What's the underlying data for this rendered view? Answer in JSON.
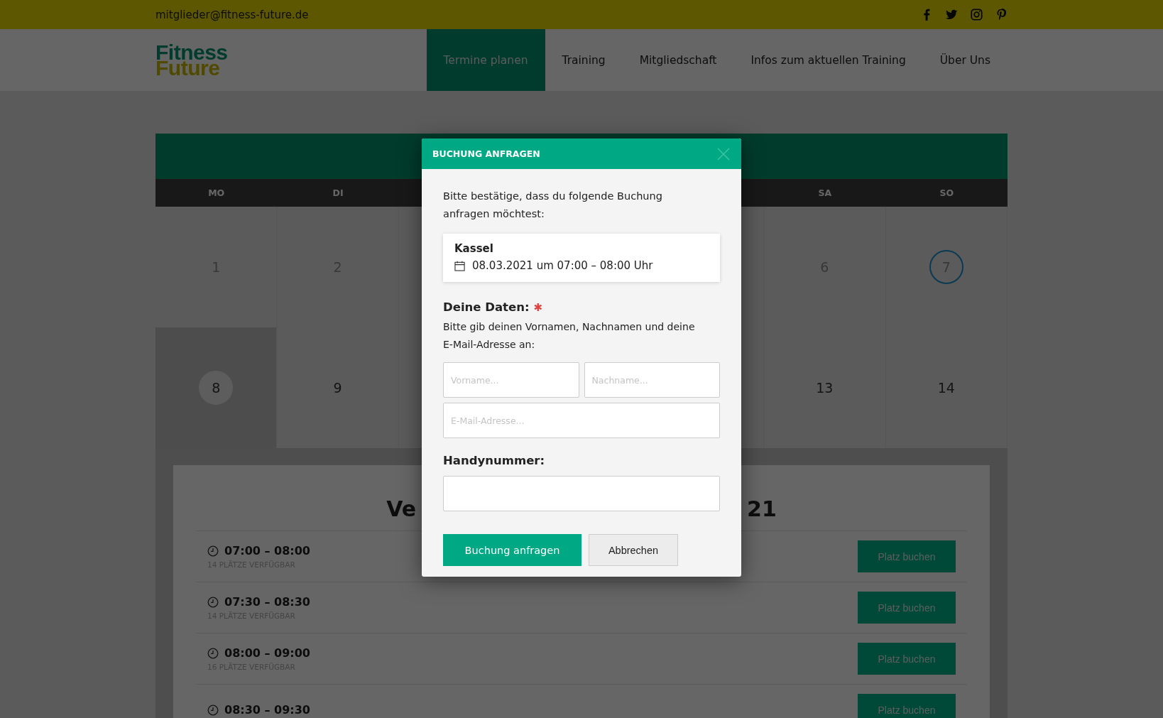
{
  "top_bar": {
    "email": "mitglieder@fitness-future.de"
  },
  "logo": {
    "line_1": "Fitness",
    "line_2": "Future"
  },
  "nav": [
    {
      "label": "Termine planen",
      "selected": true
    },
    {
      "label": "Training",
      "selected": false
    },
    {
      "label": "Mitgliedschaft",
      "selected": false
    },
    {
      "label": "Infos zum aktuellen Training",
      "selected": false
    },
    {
      "label": "Über Uns",
      "selected": false
    }
  ],
  "calendar": {
    "weekdays": [
      "MO",
      "DI",
      "SA",
      "SO"
    ],
    "weeks": [
      [
        {
          "day": "1",
          "past": true,
          "today": false,
          "selected": false
        },
        {
          "day": "2",
          "past": true,
          "today": false,
          "selected": false
        },
        {
          "day": "6",
          "past": true,
          "today": false,
          "selected": false
        },
        {
          "day": "7",
          "past": true,
          "today": true,
          "selected": false
        }
      ],
      [
        {
          "day": "8",
          "past": false,
          "today": false,
          "selected": true
        },
        {
          "day": "9",
          "past": false,
          "today": false,
          "selected": false
        },
        {
          "day": "13",
          "past": false,
          "today": false,
          "selected": false
        },
        {
          "day": "14",
          "past": false,
          "today": false,
          "selected": false
        }
      ]
    ]
  },
  "slots": {
    "title_start": "Ve",
    "title_end": "21",
    "rows": [
      {
        "time": "07:00 – 08:00",
        "places": "14 PLÄTZE VERFÜGBAR",
        "button": "Platz buchen"
      },
      {
        "time": "07:30 – 08:30",
        "places": "14 PLÄTZE VERFÜGBAR",
        "button": "Platz buchen"
      },
      {
        "time": "08:00 – 09:00",
        "places": "16 PLÄTZE VERFÜGBAR",
        "button": "Platz buchen"
      },
      {
        "time": "08:30 – 09:30",
        "button": "Platz buchen"
      }
    ]
  },
  "modal": {
    "title": "BUCHUNG ANFRAGEN",
    "intro": "Bitte bestätige, dass du folgende Buchung anfragen möchtest:",
    "booking": {
      "location": "Kassel",
      "datetime": "08.03.2021 um 07:00 – 08:00 Uhr"
    },
    "data_heading": "Deine Daten:",
    "required_mark": "✱",
    "data_hint": "Bitte gib deinen Vornamen, Nachnamen und deine E-Mail-Adresse an:",
    "fields": [
      {
        "placeholder": "Vorname..."
      },
      {
        "placeholder": "Nachname..."
      },
      {
        "placeholder": "E-Mail-Adresse..."
      }
    ],
    "phone_label": "Handynummer:",
    "buttons": [
      {
        "label": "Buchung anfragen",
        "kind": "primary"
      },
      {
        "label": "Abbrechen",
        "kind": "secondary"
      }
    ]
  }
}
